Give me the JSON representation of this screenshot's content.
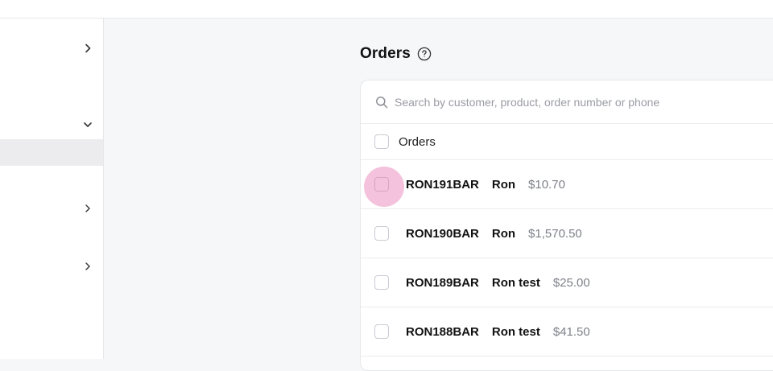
{
  "page": {
    "title": "Orders"
  },
  "search": {
    "placeholder": "Search by customer, product, order number or phone"
  },
  "list": {
    "header_label": "Orders",
    "rows": [
      {
        "order_number": "RON191BAR",
        "customer": "Ron",
        "amount": "$10.70"
      },
      {
        "order_number": "RON190BAR",
        "customer": "Ron",
        "amount": "$1,570.50"
      },
      {
        "order_number": "RON189BAR",
        "customer": "Ron test",
        "amount": "$25.00"
      },
      {
        "order_number": "RON188BAR",
        "customer": "Ron test",
        "amount": "$41.50"
      }
    ]
  },
  "icons": {
    "help": "help-circle-icon",
    "search": "search-icon",
    "sidebar_chevrons": [
      "chevron-right-icon",
      "chevron-down-icon",
      "chevron-right-icon",
      "chevron-right-icon"
    ]
  },
  "colors": {
    "focus_ring": "#f4c2dc",
    "sidebar_active": "#ececee"
  }
}
